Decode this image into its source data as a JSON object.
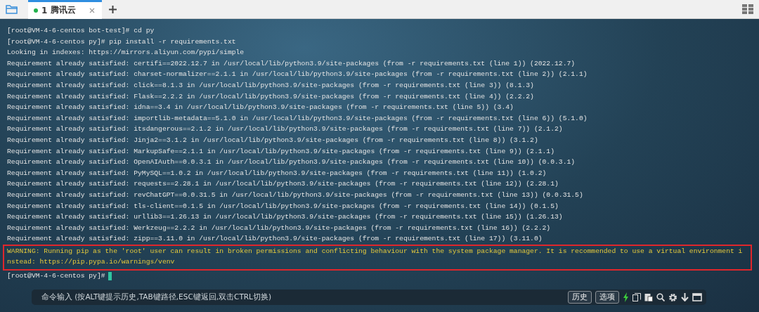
{
  "tabs": [
    {
      "number": "1",
      "label": "腾讯云",
      "connected": true,
      "selected": true
    }
  ],
  "terminal": {
    "lines": [
      {
        "kind": "prompt",
        "text": "[root@VM-4-6-centos bot-test]# cd py"
      },
      {
        "kind": "prompt",
        "text": "[root@VM-4-6-centos py]# pip install -r requirements.txt"
      },
      {
        "kind": "output",
        "text": "Looking in indexes: https://mirrors.aliyun.com/pypi/simple"
      },
      {
        "kind": "output",
        "text": "Requirement already satisfied: certifi==2022.12.7 in /usr/local/lib/python3.9/site-packages (from -r requirements.txt (line 1)) (2022.12.7)"
      },
      {
        "kind": "output",
        "text": "Requirement already satisfied: charset-normalizer==2.1.1 in /usr/local/lib/python3.9/site-packages (from -r requirements.txt (line 2)) (2.1.1)"
      },
      {
        "kind": "output",
        "text": "Requirement already satisfied: click==8.1.3 in /usr/local/lib/python3.9/site-packages (from -r requirements.txt (line 3)) (8.1.3)"
      },
      {
        "kind": "output",
        "text": "Requirement already satisfied: Flask==2.2.2 in /usr/local/lib/python3.9/site-packages (from -r requirements.txt (line 4)) (2.2.2)"
      },
      {
        "kind": "output",
        "text": "Requirement already satisfied: idna==3.4 in /usr/local/lib/python3.9/site-packages (from -r requirements.txt (line 5)) (3.4)"
      },
      {
        "kind": "output",
        "text": "Requirement already satisfied: importlib-metadata==5.1.0 in /usr/local/lib/python3.9/site-packages (from -r requirements.txt (line 6)) (5.1.0)"
      },
      {
        "kind": "output",
        "text": "Requirement already satisfied: itsdangerous==2.1.2 in /usr/local/lib/python3.9/site-packages (from -r requirements.txt (line 7)) (2.1.2)"
      },
      {
        "kind": "output",
        "text": "Requirement already satisfied: Jinja2==3.1.2 in /usr/local/lib/python3.9/site-packages (from -r requirements.txt (line 8)) (3.1.2)"
      },
      {
        "kind": "output",
        "text": "Requirement already satisfied: MarkupSafe==2.1.1 in /usr/local/lib/python3.9/site-packages (from -r requirements.txt (line 9)) (2.1.1)"
      },
      {
        "kind": "output",
        "text": "Requirement already satisfied: OpenAIAuth==0.0.3.1 in /usr/local/lib/python3.9/site-packages (from -r requirements.txt (line 10)) (0.0.3.1)"
      },
      {
        "kind": "output",
        "text": "Requirement already satisfied: PyMySQL==1.0.2 in /usr/local/lib/python3.9/site-packages (from -r requirements.txt (line 11)) (1.0.2)"
      },
      {
        "kind": "output",
        "text": "Requirement already satisfied: requests==2.28.1 in /usr/local/lib/python3.9/site-packages (from -r requirements.txt (line 12)) (2.28.1)"
      },
      {
        "kind": "output",
        "text": "Requirement already satisfied: revChatGPT==0.0.31.5 in /usr/local/lib/python3.9/site-packages (from -r requirements.txt (line 13)) (0.0.31.5)"
      },
      {
        "kind": "output",
        "text": "Requirement already satisfied: tls-client==0.1.5 in /usr/local/lib/python3.9/site-packages (from -r requirements.txt (line 14)) (0.1.5)"
      },
      {
        "kind": "output",
        "text": "Requirement already satisfied: urllib3==1.26.13 in /usr/local/lib/python3.9/site-packages (from -r requirements.txt (line 15)) (1.26.13)"
      },
      {
        "kind": "output",
        "text": "Requirement already satisfied: Werkzeug==2.2.2 in /usr/local/lib/python3.9/site-packages (from -r requirements.txt (line 16)) (2.2.2)"
      },
      {
        "kind": "output",
        "text": "Requirement already satisfied: zipp==3.11.0 in /usr/local/lib/python3.9/site-packages (from -r requirements.txt (line 17)) (3.11.0)"
      },
      {
        "kind": "warning",
        "text": "WARNING: Running pip as the 'root' user can result in broken permissions and conflicting behaviour with the system package manager. It is recommended to use a virtual environment i"
      },
      {
        "kind": "warning",
        "text": "nstead: https://pip.pypa.io/warnings/venv"
      },
      {
        "kind": "prompt",
        "text": "[root@VM-4-6-centos py]#",
        "cursor": true
      }
    ]
  },
  "command_bar": {
    "placeholder": "命令输入 (按ALT键提示历史,TAB键路径,ESC键返回,双击CTRL切换)",
    "buttons": [
      "历史",
      "选项"
    ]
  }
}
